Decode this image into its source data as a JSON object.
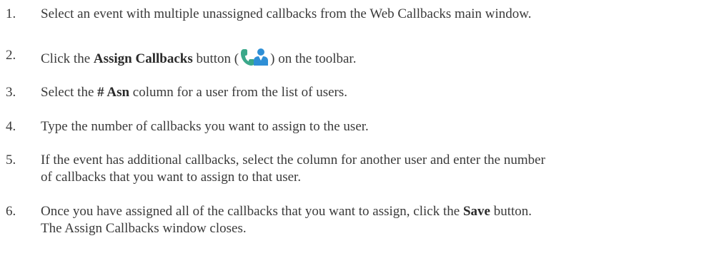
{
  "steps": [
    {
      "number": "1.",
      "text": "Select an event with multiple unassigned callbacks from the Web Callbacks main window."
    },
    {
      "number": "2.",
      "pre": "Click the ",
      "bold": "Assign Callbacks",
      "mid": " button (",
      "icon": "assign-callbacks-icon",
      "post": ") on the toolbar."
    },
    {
      "number": "3.",
      "pre": "Select the ",
      "bold": "# Asn",
      "post": " column for a user from the list of users."
    },
    {
      "number": "4.",
      "text": "Type the number of callbacks you want to assign to the user."
    },
    {
      "number": "5.",
      "line1": "If the event has additional callbacks, select the column for another user and enter the number",
      "line2": "of callbacks that you want to assign to that user."
    },
    {
      "number": "6.",
      "pre": "Once you have assigned all of the callbacks that you want to assign, click the ",
      "bold": "Save",
      "post": " button.",
      "line2": "The Assign Callbacks window closes."
    }
  ],
  "colors": {
    "text": "#3a3a3a",
    "phone_icon": "#3aa88a",
    "person_icon": "#2e8fd6"
  }
}
